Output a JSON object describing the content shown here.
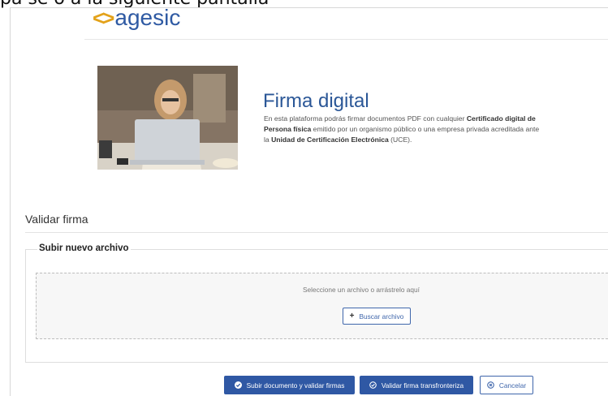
{
  "overlay_text": "pa se o a la siguiente pantalla",
  "header": {
    "logo_mark": "<>",
    "logo_text": "agesic"
  },
  "hero": {
    "title": "Firma digital",
    "description": {
      "t1": "En esta plataforma podrás firmar documentos PDF con cualquier ",
      "b1": "Certificado digital de Persona física",
      "t2": " emitido por un organismo público o una empresa privada acreditada ante la ",
      "b2": "Unidad de Certificación Electrónica",
      "t3": " (UCE)."
    }
  },
  "validate": {
    "section_title": "Validar firma",
    "upload_legend": "Subir nuevo archivo",
    "drop_hint": "Seleccione un archivo o arrástrelo aquí",
    "browse_label": "Buscar archivo"
  },
  "actions": {
    "submit_label": "Subir documento y validar firmas",
    "cross_border_label": "Validar firma transfronteriza",
    "cancel_label": "Cancelar"
  },
  "colors": {
    "brand_blue": "#2f58a4",
    "logo_orange": "#e3a21a",
    "title_blue": "#2b5797"
  }
}
